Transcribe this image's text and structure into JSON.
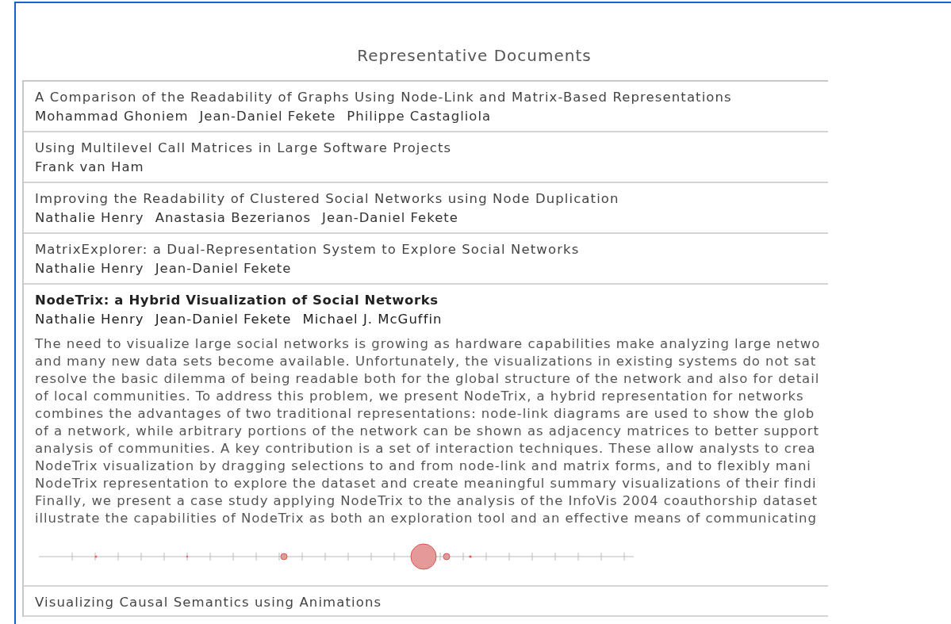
{
  "heading": "Representative Documents",
  "documents": [
    {
      "title": "A Comparison of the Readability of Graphs Using Node-Link and Matrix-Based Representations",
      "authors": [
        "Mohammad Ghoniem",
        "Jean-Daniel Fekete",
        "Philippe Castagliola"
      ],
      "expanded": false
    },
    {
      "title": "Using Multilevel Call Matrices in Large Software Projects",
      "authors": [
        "Frank van Ham"
      ],
      "expanded": false
    },
    {
      "title": "Improving the Readability of Clustered Social Networks using Node Duplication",
      "authors": [
        "Nathalie Henry",
        "Anastasia Bezerianos",
        "Jean-Daniel Fekete"
      ],
      "expanded": false
    },
    {
      "title": "MatrixExplorer: a Dual-Representation System to Explore Social Networks",
      "authors": [
        "Nathalie Henry",
        "Jean-Daniel Fekete"
      ],
      "expanded": false
    },
    {
      "title": "NodeTrix: a Hybrid Visualization of Social Networks",
      "authors": [
        "Nathalie Henry",
        "Jean-Daniel Fekete",
        "Michael J. McGuffin"
      ],
      "expanded": true,
      "abstract_lines": [
        "The need to visualize large social networks is growing as hardware capabilities make analyzing large netwo",
        "and many new data sets become available. Unfortunately, the visualizations in existing systems do not sat",
        "resolve the basic dilemma of being readable both for the global structure of the network and also for detail",
        "of local communities. To address this problem, we present NodeTrix, a hybrid representation for networks",
        "combines the advantages of two traditional representations: node-link diagrams are used to show the glob",
        "of a network, while arbitrary portions of the network can be shown as adjacency matrices to better support",
        "analysis of communities. A key contribution is a set of interaction techniques. These allow analysts to crea",
        "NodeTrix visualization by dragging selections to and from node-link and matrix forms, and to flexibly mani",
        "NodeTrix representation to explore the dataset and create meaningful summary visualizations of their findi",
        "Finally, we present a case study applying NodeTrix to the analysis of the InfoVis 2004 coauthorship dataset",
        "illustrate the capabilities of NodeTrix as both an exploration tool and an effective means of communicating"
      ]
    },
    {
      "title": "Visualizing Causal Semantics using Animations",
      "expanded": false
    }
  ]
}
